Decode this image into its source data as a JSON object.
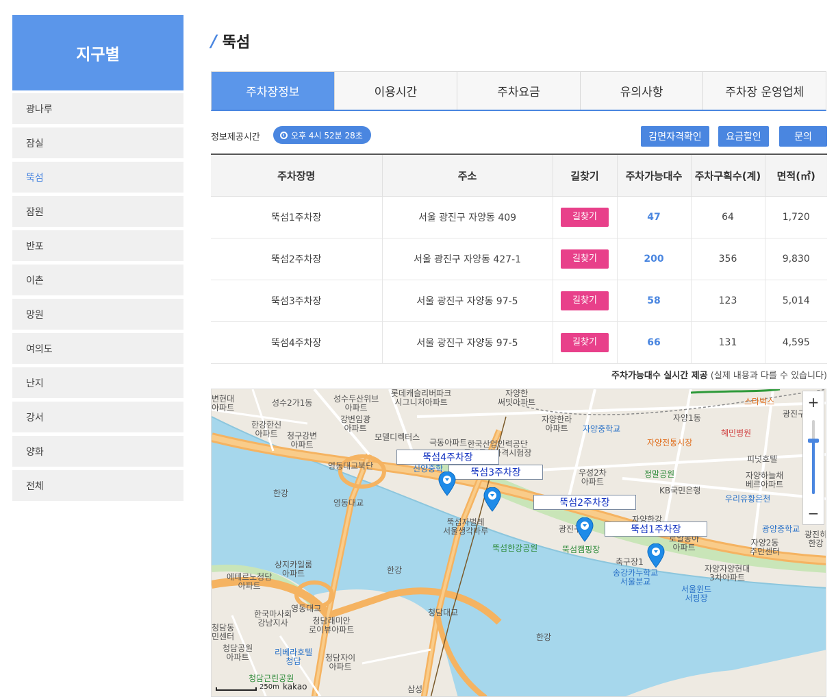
{
  "sidebar": {
    "title": "지구별",
    "items": [
      {
        "label": "광나루",
        "active": false
      },
      {
        "label": "잠실",
        "active": false
      },
      {
        "label": "뚝섬",
        "active": true
      },
      {
        "label": "잠원",
        "active": false
      },
      {
        "label": "반포",
        "active": false
      },
      {
        "label": "이촌",
        "active": false
      },
      {
        "label": "망원",
        "active": false
      },
      {
        "label": "여의도",
        "active": false
      },
      {
        "label": "난지",
        "active": false
      },
      {
        "label": "강서",
        "active": false
      },
      {
        "label": "양화",
        "active": false
      },
      {
        "label": "전체",
        "active": false
      }
    ]
  },
  "page": {
    "title": "뚝섬"
  },
  "tabs": [
    {
      "label": "주차장정보",
      "active": true
    },
    {
      "label": "이용시간",
      "active": false
    },
    {
      "label": "주차요금",
      "active": false
    },
    {
      "label": "유의사항",
      "active": false
    },
    {
      "label": "주차장 운영업체",
      "active": false
    }
  ],
  "info": {
    "label": "정보제공시간",
    "time": "오후 4시 52분 28초",
    "buttons": {
      "exempt": "감면자격확인",
      "discount": "요금할인",
      "inquiry": "문의"
    }
  },
  "table": {
    "headers": [
      "주차장명",
      "주소",
      "길찾기",
      "주차가능대수",
      "주차구획수(계)",
      "면적(㎡)"
    ],
    "directions_label": "길찾기",
    "rows": [
      {
        "name": "뚝섬1주차장",
        "address": "서울 광진구 자양동 409",
        "available": "47",
        "spaces": "64",
        "area": "1,720"
      },
      {
        "name": "뚝섬2주차장",
        "address": "서울 광진구 자양동 427-1",
        "available": "200",
        "spaces": "356",
        "area": "9,830"
      },
      {
        "name": "뚝섬3주차장",
        "address": "서울 광진구 자양동 97-5",
        "available": "58",
        "spaces": "123",
        "area": "5,014"
      },
      {
        "name": "뚝섬4주차장",
        "address": "서울 광진구 자양동 97-5",
        "available": "66",
        "spaces": "131",
        "area": "4,595"
      }
    ]
  },
  "realtime_note": {
    "bold": "주차가능대수 실시간 제공",
    "rest": "(실제 내용과 다를 수 있습니다)"
  },
  "map": {
    "lot_labels": [
      "뚝섬4주차장",
      "뚝섬3주차장",
      "뚝섬2주차장",
      "뚝섬1주차장"
    ],
    "zoom_in": "+",
    "zoom_out": "−",
    "zoom_level": 0.72,
    "scale": "250m",
    "brand": "kakao",
    "places": [
      {
        "text": "변현대\n아파트",
        "color": "gray"
      },
      {
        "text": "성수2가1동",
        "color": "gray"
      },
      {
        "text": "성수두산위브\n아파트",
        "color": "gray"
      },
      {
        "text": "롯데캐슬리버파크\n시그니처아파트",
        "color": "gray"
      },
      {
        "text": "자양한\n써밋아파트",
        "color": "gray"
      },
      {
        "text": "한강한신\n아파트",
        "color": "gray"
      },
      {
        "text": "강변임광\n아파트",
        "color": "gray"
      },
      {
        "text": "청구강변\n아파트",
        "color": "gray"
      },
      {
        "text": "모델디렉터스",
        "color": "gray"
      },
      {
        "text": "극동아파트",
        "color": "gray"
      },
      {
        "text": "한국산업인력공단\n동부국가자격시험장",
        "color": "gray"
      },
      {
        "text": "자양한라\n아파트",
        "color": "gray"
      },
      {
        "text": "자양중학교",
        "color": "blue"
      },
      {
        "text": "자양1동",
        "color": "gray"
      },
      {
        "text": "자양전통시장",
        "color": "orange"
      },
      {
        "text": "혜민병원",
        "color": "red"
      },
      {
        "text": "스타벅스",
        "color": "orange"
      },
      {
        "text": "광진구",
        "color": "gray"
      },
      {
        "text": "피넛호텔",
        "color": "gray"
      },
      {
        "text": "영동대교북단",
        "color": "gray"
      },
      {
        "text": "신양중학",
        "color": "blue"
      },
      {
        "text": "우성2차\n아파트",
        "color": "gray"
      },
      {
        "text": "정말공원",
        "color": "green"
      },
      {
        "text": "자양하늘채\n베르아파트",
        "color": "gray"
      },
      {
        "text": "KB국민은행",
        "color": "gray"
      },
      {
        "text": "우리유황온천",
        "color": "blue"
      },
      {
        "text": "한강",
        "color": "gray"
      },
      {
        "text": "영동대교",
        "color": "gray"
      },
      {
        "text": "뚝섬자벌레\n서울생각마루",
        "color": "gray"
      },
      {
        "text": "자양한강",
        "color": "gray"
      },
      {
        "text": "광진구",
        "color": "gray"
      },
      {
        "text": "광양중학교",
        "color": "blue"
      },
      {
        "text": "뚝섬한강공원",
        "color": "green"
      },
      {
        "text": "뚝섬캠핑장",
        "color": "green"
      },
      {
        "text": "로얄동아\n아파트",
        "color": "gray"
      },
      {
        "text": "자양2동\n주민센터",
        "color": "gray"
      },
      {
        "text": "광진히\n한강",
        "color": "gray"
      },
      {
        "text": "상지카일룸\n아파트",
        "color": "gray"
      },
      {
        "text": "축구장1",
        "color": "gray"
      },
      {
        "text": "송강카누학교\n서울분교",
        "color": "blue"
      },
      {
        "text": "자양자양현대\n3차아파트",
        "color": "gray"
      },
      {
        "text": "에테르노청담\n아파트",
        "color": "gray"
      },
      {
        "text": "한강",
        "color": "gray"
      },
      {
        "text": "서울윈드\n서핑장",
        "color": "blue"
      },
      {
        "text": "영동대교",
        "color": "gray"
      },
      {
        "text": "한국마사회\n강남지사",
        "color": "gray"
      },
      {
        "text": "청담래미안\n로이뷰아파트",
        "color": "gray"
      },
      {
        "text": "청담대교",
        "color": "gray"
      },
      {
        "text": "한강",
        "color": "gray"
      },
      {
        "text": "청담동\n민센터",
        "color": "gray"
      },
      {
        "text": "청담공원\n아파트",
        "color": "gray"
      },
      {
        "text": "리베라호텔\n청담",
        "color": "blue"
      },
      {
        "text": "청담자이\n아파트",
        "color": "gray"
      },
      {
        "text": "청담근린공원",
        "color": "green"
      },
      {
        "text": "삼성",
        "color": "gray"
      }
    ]
  }
}
